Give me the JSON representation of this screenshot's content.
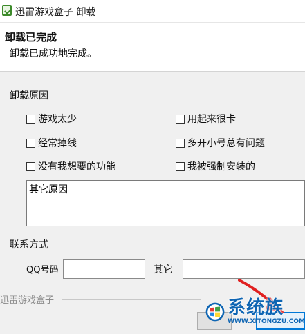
{
  "window": {
    "title": "迅雷游戏盒子 卸载"
  },
  "header": {
    "title": "卸载已完成",
    "subtitle": "卸载已成功地完成。"
  },
  "reasons": {
    "label": "卸载原因",
    "options": [
      "游戏太少",
      "用起来很卡",
      "经常掉线",
      "多开小号总有问题",
      "没有我想要的功能",
      "我被强制安装的"
    ],
    "other_text": "其它原因"
  },
  "contact": {
    "label": "联系方式",
    "qq_label": "QQ号码",
    "qq_value": "",
    "other_label": "其它",
    "other_value": ""
  },
  "footer": {
    "brand": "迅雷游戏盒子"
  },
  "watermark": {
    "text": "系统族",
    "url": "WWW.XITONGZU.COM"
  },
  "colors": {
    "arrow": "#e02020",
    "focus_border": "#0078d7",
    "watermark_blue": "#0e65b3"
  }
}
